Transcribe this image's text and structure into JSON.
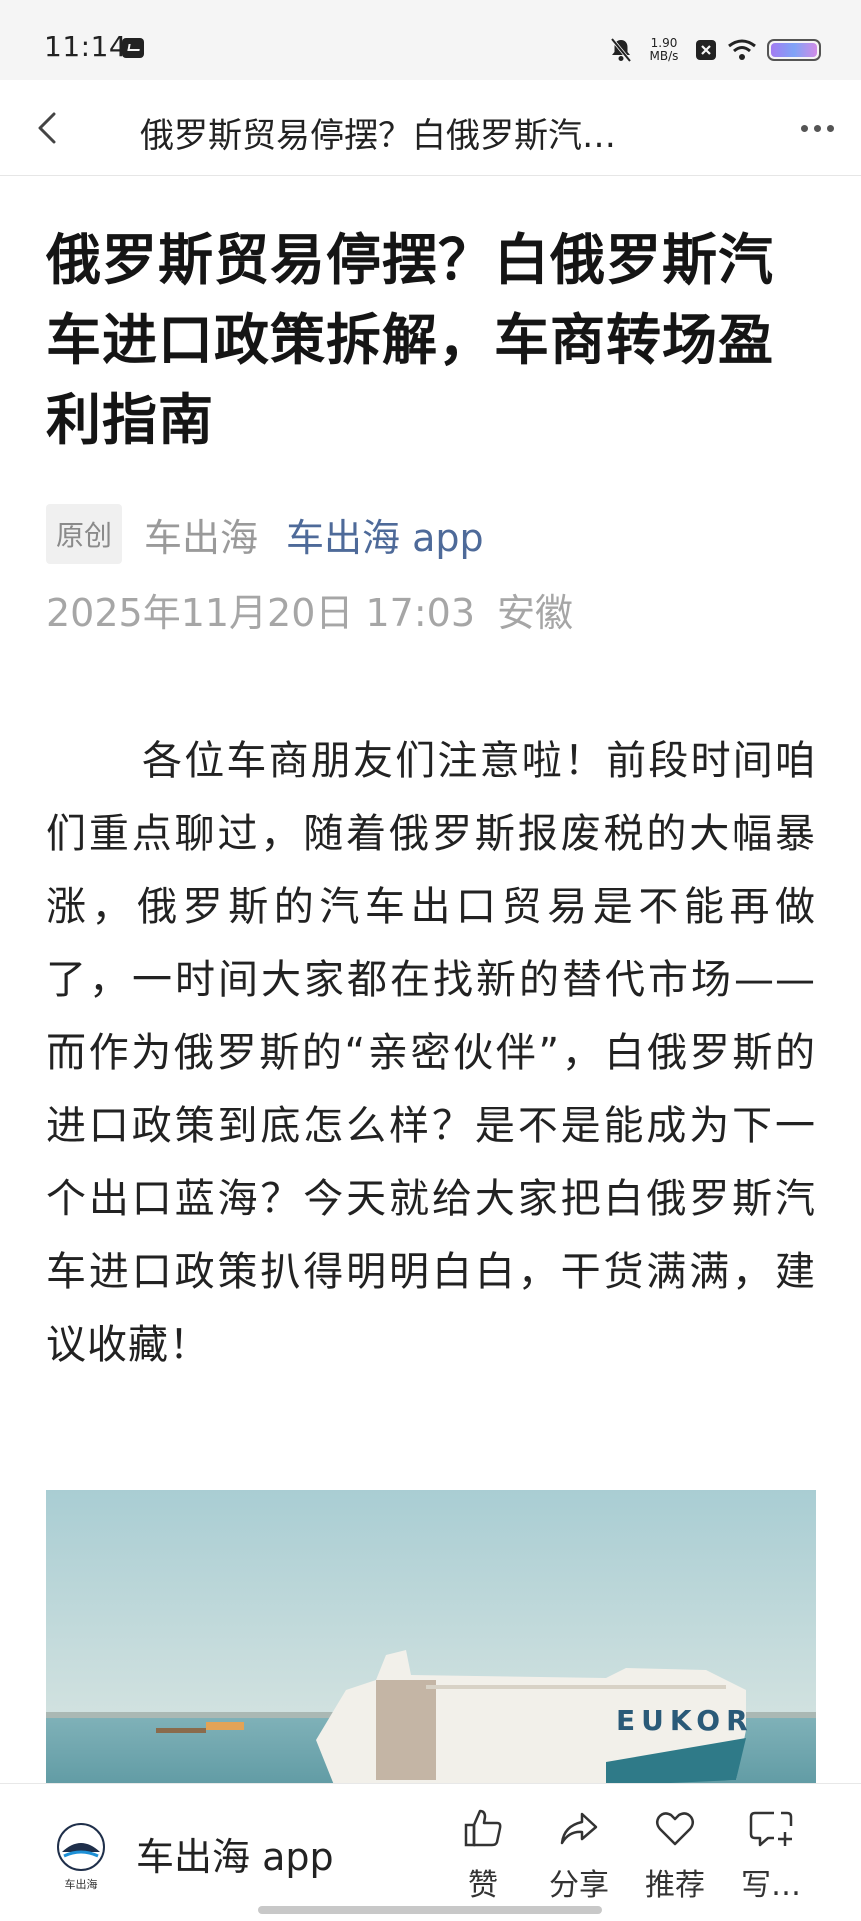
{
  "status_bar": {
    "time": "11:14",
    "network_speed_value": "1.90",
    "network_speed_unit": "MB/s",
    "icons": [
      "message-icon",
      "bell-off-icon",
      "close-box-icon",
      "wifi-icon",
      "battery-icon"
    ]
  },
  "nav": {
    "title": "俄罗斯贸易停摆？白俄罗斯汽…",
    "back_icon": "chevron-left-icon",
    "more_icon": "more-horizontal-icon"
  },
  "article": {
    "title": "俄罗斯贸易停摆？白俄罗斯汽车进口政策拆解，车商转场盈利指南",
    "tag": "原创",
    "author": "车出海",
    "account": "车出海 app",
    "date": "2025年11月20日 17:03",
    "location": "安徽",
    "paragraph": "各位车商朋友们注意啦！前段时间咱们重点聊过，随着俄罗斯报废税的大幅暴涨，俄罗斯的汽车出口贸易是不能再做了，一时间大家都在找新的替代市场——而作为俄罗斯的“亲密伙伴”，白俄罗斯的进口政策到底怎么样？是不是能成为下一个出口蓝海？今天就给大家把白俄罗斯汽车进口政策扒得明明白白，干货满满，建议收藏！",
    "image_ship_text": "EUKOR"
  },
  "bottom_bar": {
    "brand_logo_text": "车出海",
    "brand_name": "车出海 app",
    "actions": [
      {
        "label": "赞",
        "icon": "thumbs-up-icon"
      },
      {
        "label": "分享",
        "icon": "share-icon"
      },
      {
        "label": "推荐",
        "icon": "heart-icon"
      },
      {
        "label": "写…",
        "icon": "comment-add-icon"
      }
    ]
  },
  "colors": {
    "account_link": "#4e6a99",
    "meta_gray": "#a6a6a6",
    "status_bg": "#f5f5f5"
  }
}
